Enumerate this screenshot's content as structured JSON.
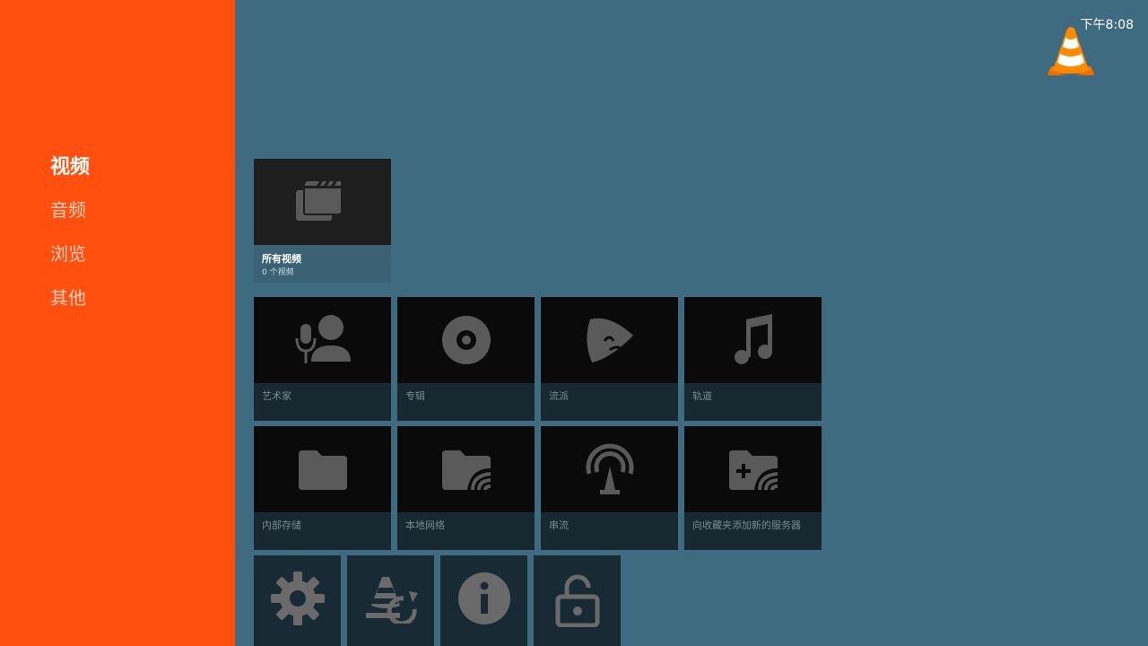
{
  "clock": "下午8:08",
  "sidebar": {
    "items": [
      {
        "label": "视频",
        "active": true
      },
      {
        "label": "音频"
      },
      {
        "label": "浏览"
      },
      {
        "label": "其他"
      }
    ]
  },
  "featured": {
    "title": "所有视频",
    "subtitle": "0 个视频",
    "icon": "movie-icon"
  },
  "media_rows": [
    [
      {
        "label": "艺术家",
        "icon": "artist-icon"
      },
      {
        "label": "专辑",
        "icon": "album-icon"
      },
      {
        "label": "流派",
        "icon": "genre-icon"
      },
      {
        "label": "轨道",
        "icon": "music-note-icon"
      }
    ],
    [
      {
        "label": "内部存储",
        "icon": "folder-icon"
      },
      {
        "label": "本地网络",
        "icon": "network-folder-icon"
      },
      {
        "label": "串流",
        "icon": "stream-icon"
      },
      {
        "label": "向收藏夹添加新的服务器",
        "icon": "add-server-icon"
      }
    ]
  ],
  "tools": [
    {
      "icon": "settings-gear-icon"
    },
    {
      "icon": "vlc-refresh-icon"
    },
    {
      "icon": "info-icon"
    },
    {
      "icon": "unlock-icon"
    }
  ],
  "colors": {
    "sidebar": "#ff5010",
    "background": "#3e6b80",
    "card_art": "#0a0a0a",
    "card_label_bar": "#182830",
    "icon": "#5a5a5a"
  }
}
